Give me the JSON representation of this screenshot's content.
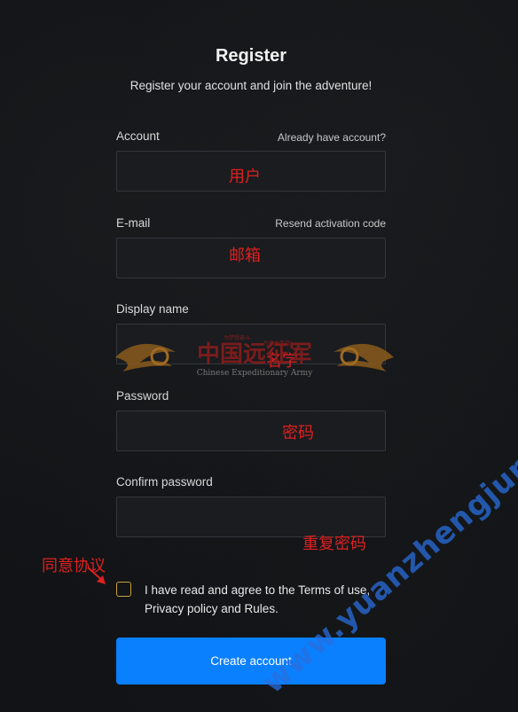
{
  "form": {
    "title": "Register",
    "subtitle": "Register your account and join the adventure!",
    "account_label": "Account",
    "already_have_account": "Already have account?",
    "email_label": "E-mail",
    "resend_activation": "Resend activation code",
    "display_name_label": "Display name",
    "password_label": "Password",
    "confirm_password_label": "Confirm password",
    "agree_text": "I have read and agree to the Terms of use, Privacy policy and Rules.",
    "create_button": "Create account"
  },
  "annotations": {
    "account": "用户",
    "email": "邮箱",
    "display_name": "名字",
    "password": "密码",
    "confirm_password": "重复密码",
    "agree": "同意协议"
  },
  "overlay": {
    "logo_cn": "中国远征军",
    "logo_en": "Chinese Expeditionary Army",
    "logo_small_left": "为梦想奋斗,",
    "logo_small_right": "为自由而战!",
    "watermark": "www.yuanzhengjun.xyz"
  },
  "colors": {
    "background": "#111316",
    "field_bg": "#1a1c1f",
    "button": "#0a80ff",
    "checkbox_border": "#c9a43a",
    "annotation": "#e02020",
    "watermark": "#2e6edc"
  }
}
